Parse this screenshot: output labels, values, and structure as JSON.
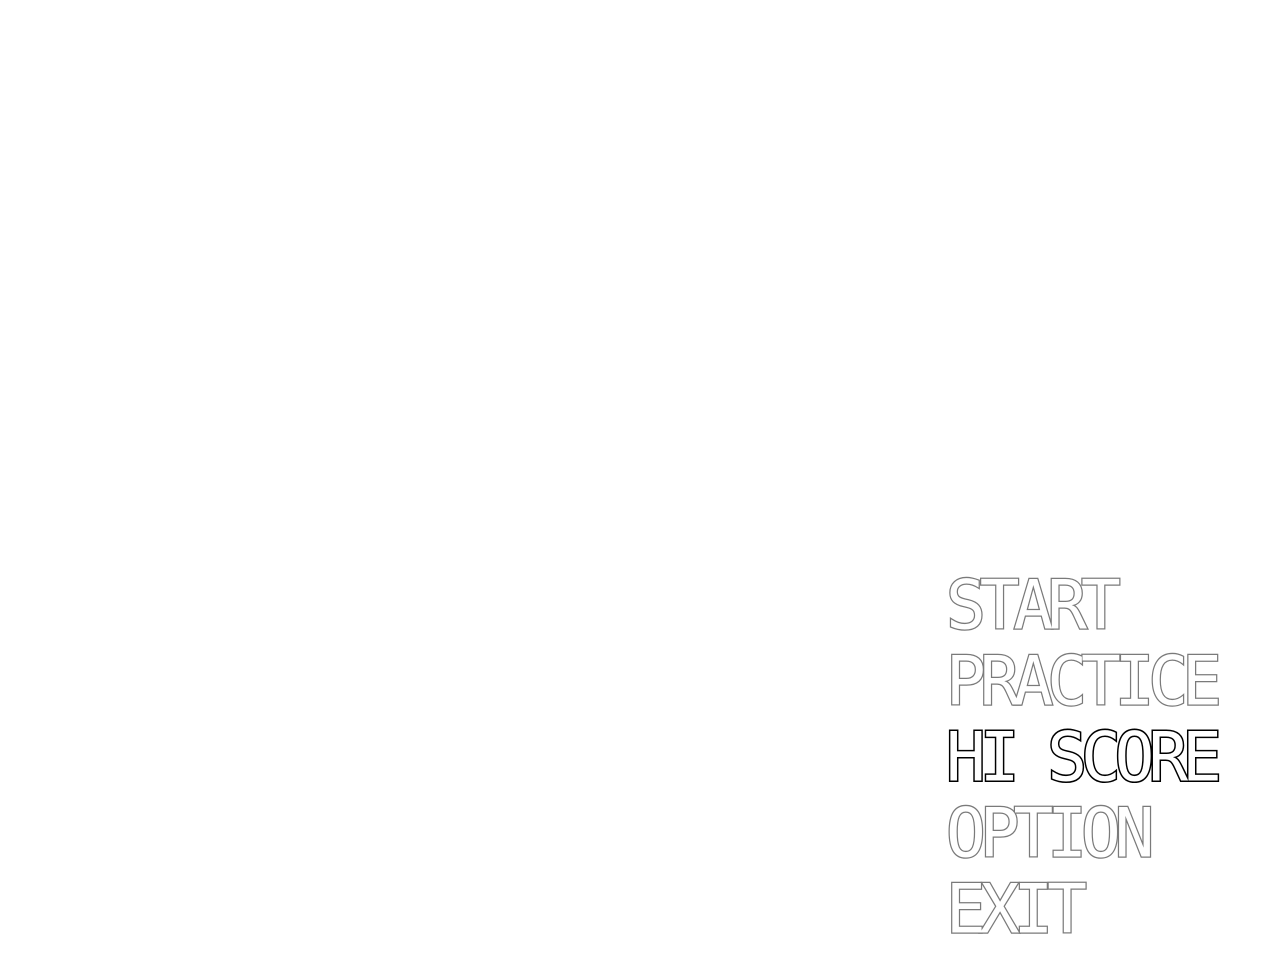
{
  "menu": {
    "items": [
      {
        "label": "START",
        "selected": false
      },
      {
        "label": "PRACTICE",
        "selected": false
      },
      {
        "label": "HI SCORE",
        "selected": true
      },
      {
        "label": "OPTION",
        "selected": false
      },
      {
        "label": "EXIT",
        "selected": false
      }
    ]
  },
  "colors": {
    "background": "#ffffff",
    "item_outline": "#7a7a7a",
    "selected_outline": "#000000",
    "item_fill": "#ffffff"
  }
}
